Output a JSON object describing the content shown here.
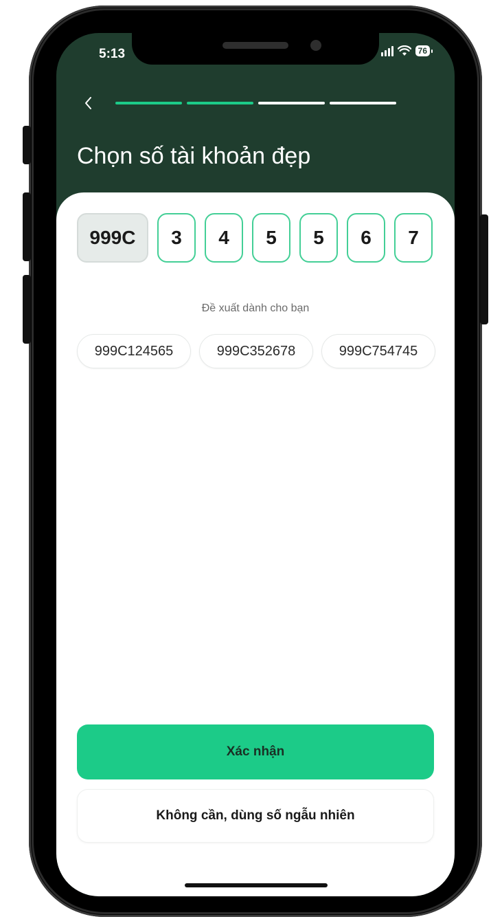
{
  "status_bar": {
    "time": "5:13",
    "battery": "76"
  },
  "header": {
    "back_icon": "chevron-left-icon",
    "title": "Chọn số tài khoản đẹp",
    "progress_steps_total": 4,
    "progress_steps_done": 2
  },
  "account_number": {
    "prefix": "999C",
    "digits": [
      "3",
      "4",
      "5",
      "5",
      "6",
      "7"
    ]
  },
  "suggestions": {
    "label": "Đề xuất dành cho bạn",
    "items": [
      "999C124565",
      "999C352678",
      "999C754745"
    ]
  },
  "actions": {
    "confirm_label": "Xác nhận",
    "random_label": "Không cần, dùng số ngẫu nhiên"
  },
  "colors": {
    "header_bg": "#1f3d2e",
    "accent": "#1ccb88",
    "digit_border": "#43cf96"
  }
}
